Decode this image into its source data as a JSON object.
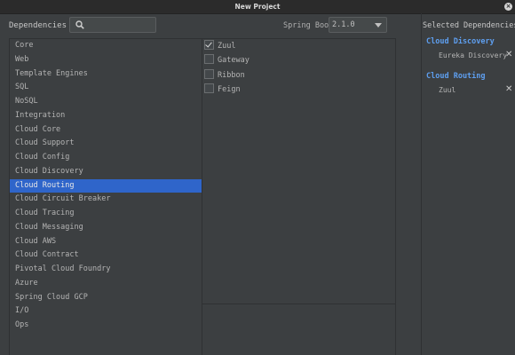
{
  "window": {
    "title": "New Project",
    "close_glyph": "×"
  },
  "toolbar": {
    "dependencies_label": "Dependencies",
    "search_value": "",
    "search_placeholder": "",
    "spring_boot_label": "Spring Boot",
    "spring_boot_version": "2.1.0"
  },
  "categories": [
    "Core",
    "Web",
    "Template Engines",
    "SQL",
    "NoSQL",
    "Integration",
    "Cloud Core",
    "Cloud Support",
    "Cloud Config",
    "Cloud Discovery",
    "Cloud Routing",
    "Cloud Circuit Breaker",
    "Cloud Tracing",
    "Cloud Messaging",
    "Cloud AWS",
    "Cloud Contract",
    "Pivotal Cloud Foundry",
    "Azure",
    "Spring Cloud GCP",
    "I/O",
    "Ops"
  ],
  "selected_category": "Cloud Routing",
  "dependencies": [
    {
      "label": "Zuul",
      "checked": true
    },
    {
      "label": "Gateway",
      "checked": false
    },
    {
      "label": "Ribbon",
      "checked": false
    },
    {
      "label": "Feign",
      "checked": false
    }
  ],
  "selected_panel": {
    "header": "Selected Dependencies",
    "groups": [
      {
        "title": "Cloud Discovery",
        "items": [
          "Eureka Discovery"
        ]
      },
      {
        "title": "Cloud Routing",
        "items": [
          "Zuul"
        ]
      }
    ],
    "remove_glyph": "✕"
  },
  "colors": {
    "background": "#3c3f41",
    "selection": "#2f65ca",
    "group_title": "#5e9ff0"
  }
}
